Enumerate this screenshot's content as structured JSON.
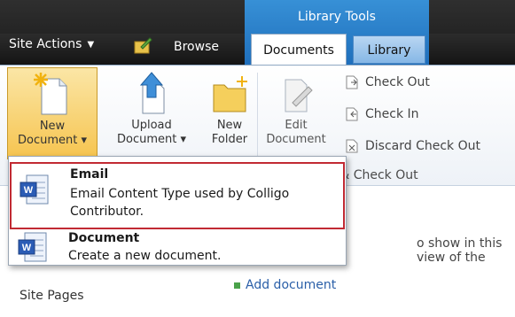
{
  "header": {
    "site_actions": "Site Actions",
    "browse_tab": "Browse",
    "context_group_title": "Library Tools",
    "tabs": [
      {
        "label": "Documents",
        "selected": true
      },
      {
        "label": "Library",
        "selected": false
      }
    ],
    "accent": "#2a7cc7"
  },
  "ribbon": {
    "new_document": {
      "line1": "New",
      "line2": "Document",
      "icon": "new-document-icon"
    },
    "upload_document": {
      "line1": "Upload",
      "line2": "Document",
      "icon": "upload-icon"
    },
    "new_folder": {
      "line1": "New",
      "line2": "Folder",
      "icon": "folder-icon"
    },
    "edit_document": {
      "line1": "Edit",
      "line2": "Document",
      "icon": "edit-document-icon"
    },
    "check_out": "Check Out",
    "check_in": "Check In",
    "discard_check_out": "Discard Check Out",
    "group_label_partial": "n & Check Out"
  },
  "dropdown": {
    "items": [
      {
        "title": "Email",
        "description": "Email Content Type used by Colligo Contributor.",
        "icon": "word-document-icon",
        "highlighted": true
      },
      {
        "title": "Document",
        "description": "Create a new document.",
        "icon": "word-document-icon",
        "highlighted": false
      }
    ],
    "highlight_color": "#c12a33"
  },
  "page": {
    "partial_text": "o show in this view of the",
    "add_document": "Add document",
    "site_pages": "Site Pages"
  }
}
